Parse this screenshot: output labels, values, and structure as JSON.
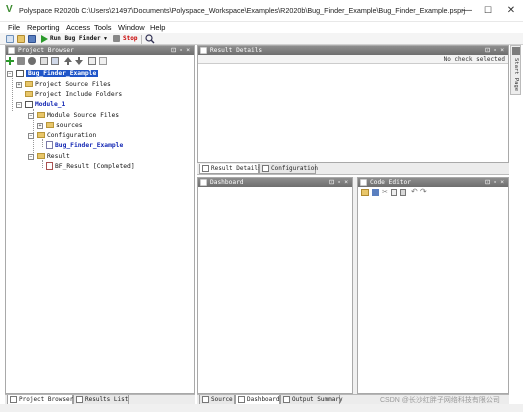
{
  "window": {
    "title": "Polyspace R2020b C:\\Users\\21497\\Documents\\Polyspace_Workspace\\Examples\\R2020b\\Bug_Finder_Example\\Bug_Finder_Example.psprj",
    "minimize": "—",
    "maximize": "☐",
    "close": "✕"
  },
  "menu": [
    "File",
    "Reporting",
    "Access",
    "Tools",
    "Window",
    "Help"
  ],
  "toolbar": {
    "run_label": "Run Bug Finder",
    "run_dropdown": "▼",
    "stop_label": "Stop"
  },
  "project_browser": {
    "title": "Project Browser",
    "controls": "⊡ ▫ ×",
    "tree": {
      "project": "Bug_Finder_Example",
      "source_files": "Project Source Files",
      "include_folders": "Project Include Folders",
      "module": "Module_1",
      "module_sources": "Module Source Files",
      "sources": "sources",
      "configuration": "Configuration",
      "config_item": "Bug_Finder_Example",
      "result": "Result",
      "result_item": "BF_Result [Completed]"
    },
    "bottom_tabs": [
      "Project Browser",
      "Results List"
    ]
  },
  "result_details": {
    "title": "Result Details",
    "controls": "⊡ ▫ ×",
    "no_check": "No check selected",
    "tabs": [
      "Result Details",
      "Configuration"
    ]
  },
  "start_page": "Start Page",
  "dashboard": {
    "title": "Dashboard",
    "controls": "⊡ ▫ ×",
    "bottom_tabs": [
      "Source",
      "Dashboard",
      "Output Summary"
    ]
  },
  "code_editor": {
    "title": "Code Editor",
    "controls": "⊡ ▫ ×"
  },
  "watermark": "CSDN @长沙红胖子网络科技有限公司",
  "colors": {
    "panel_header": "#7c7c7c",
    "selection": "#1f55c8",
    "link_blue": "#1428b4",
    "stop_red": "#c80000",
    "run_green": "#2b9a2b"
  }
}
